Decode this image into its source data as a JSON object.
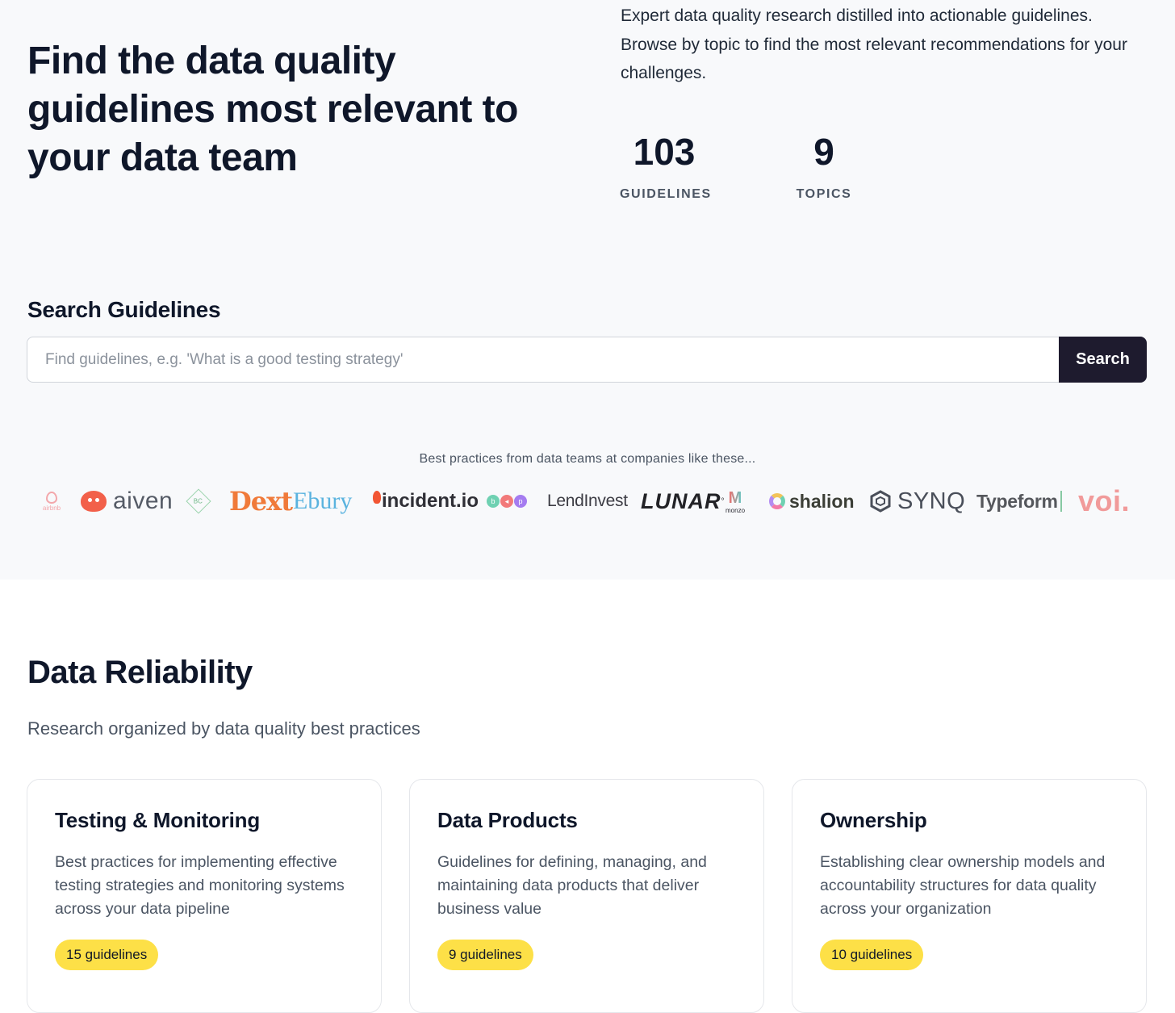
{
  "hero": {
    "title": "Find the data quality guidelines most relevant to your data team",
    "description": "Expert data quality research distilled into actionable guidelines. Browse by topic to find the most relevant recommendations for your challenges.",
    "stats": [
      {
        "value": "103",
        "label": "GUIDELINES"
      },
      {
        "value": "9",
        "label": "TOPICS"
      }
    ]
  },
  "search": {
    "heading": "Search Guidelines",
    "placeholder": "Find guidelines, e.g. 'What is a good testing strategy'",
    "value": "",
    "button_label": "Search"
  },
  "logos": {
    "caption": "Best practices from data teams at companies like these...",
    "items": [
      "airbnb",
      "aiven",
      "BC",
      "Dext",
      "Ebury",
      "incident.io",
      "b",
      "p",
      "LendInvest",
      "LUNAR",
      "monzo",
      "shalion",
      "SYNQ",
      "Typeform",
      "voi."
    ]
  },
  "section": {
    "title": "Data Reliability",
    "subtitle": "Research organized by data quality best practices"
  },
  "cards": [
    {
      "title": "Testing & Monitoring",
      "description": "Best practices for implementing effective testing strategies and monitoring systems across your data pipeline",
      "badge": "15 guidelines"
    },
    {
      "title": "Data Products",
      "description": "Guidelines for defining, managing, and maintaining data products that deliver business value",
      "badge": "9 guidelines"
    },
    {
      "title": "Ownership",
      "description": "Establishing clear ownership models and accountability structures for data quality across your organization",
      "badge": "10 guidelines"
    }
  ],
  "colors": {
    "hero_background": "#f8f9fb",
    "search_button": "#1e1b2e",
    "badge": "#fde047",
    "heading_text": "#0f172a"
  }
}
